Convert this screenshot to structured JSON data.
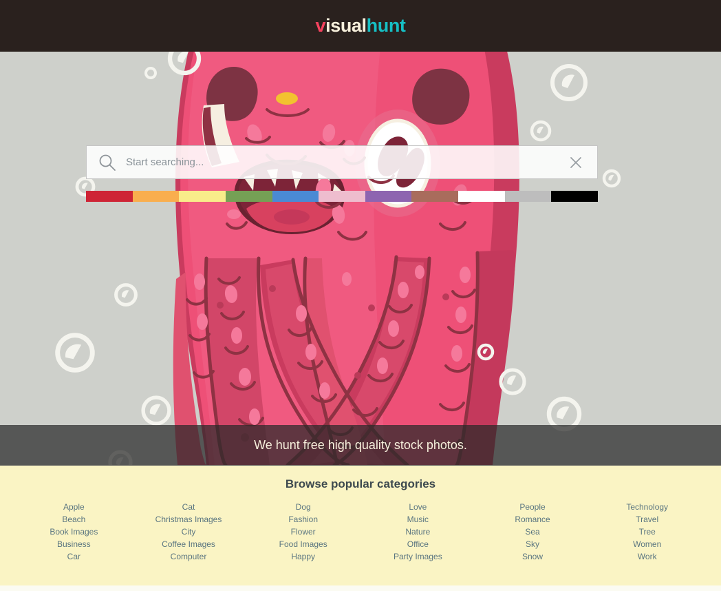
{
  "header": {
    "logo": {
      "part1": "v",
      "part2": "isual",
      "part3": "hunt",
      "color1": "#F4425E",
      "color2": "#F7F0DC",
      "color3": "#16BFC4"
    },
    "background": "#2A211E"
  },
  "hero": {
    "background": "#CED0CB",
    "illustration_name": "pink-monster-illustration",
    "bubbles_name": "bubble-decoration"
  },
  "search": {
    "value": "",
    "placeholder": "Start searching...",
    "search_icon": "search-icon",
    "clear_icon": "close-icon"
  },
  "color_filters": [
    {
      "name": "red",
      "hex": "#CE2435"
    },
    {
      "name": "orange",
      "hex": "#F9AE4E"
    },
    {
      "name": "yellow",
      "hex": "#F9EC8A"
    },
    {
      "name": "green",
      "hex": "#75A055"
    },
    {
      "name": "blue",
      "hex": "#4A8AD4"
    },
    {
      "name": "pink",
      "hex": "#EEBDCE"
    },
    {
      "name": "purple",
      "hex": "#8D64B0"
    },
    {
      "name": "brown",
      "hex": "#A96C5C"
    },
    {
      "name": "white",
      "hex": "#FFFFFF"
    },
    {
      "name": "gray",
      "hex": "#BDBDBD"
    },
    {
      "name": "black",
      "hex": "#000000"
    }
  ],
  "tagline": {
    "text": "We hunt free high quality stock photos."
  },
  "categories": {
    "title": "Browse popular categories",
    "background": "#FAF4C4",
    "link_color": "#5A7580",
    "columns": [
      {
        "items": [
          "Apple",
          "Beach",
          "Book Images",
          "Business",
          "Car"
        ]
      },
      {
        "items": [
          "Cat",
          "Christmas Images",
          "City",
          "Coffee Images",
          "Computer"
        ]
      },
      {
        "items": [
          "Dog",
          "Fashion",
          "Flower",
          "Food Images",
          "Happy"
        ]
      },
      {
        "items": [
          "Love",
          "Music",
          "Nature",
          "Office",
          "Party Images"
        ]
      },
      {
        "items": [
          "People",
          "Romance",
          "Sea",
          "Sky",
          "Snow"
        ]
      },
      {
        "items": [
          "Technology",
          "Travel",
          "Tree",
          "Women",
          "Work"
        ]
      }
    ]
  }
}
